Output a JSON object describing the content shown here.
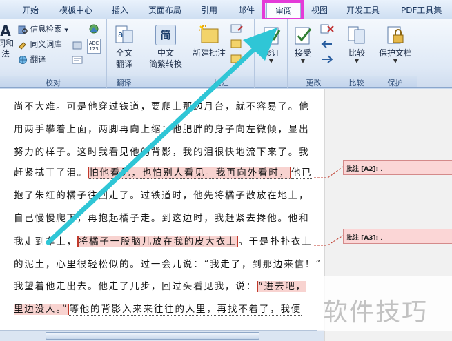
{
  "tabs": [
    "开始",
    "模板中心",
    "插入",
    "页面布局",
    "引用",
    "邮件",
    "审阅",
    "视图",
    "开发工具",
    "PDF工具集"
  ],
  "active_tab": "审阅",
  "ribbon": {
    "proofing": {
      "label": "校对",
      "spell_top": "A",
      "spell_bottom": "词和\n法",
      "research": "信息检索",
      "thesaurus": "同义词库",
      "translate": "翻译",
      "abc_text": "ABC\n123"
    },
    "translation": {
      "label": "翻译",
      "full_translate": "全文\n翻译"
    },
    "chinese": {
      "convert": "中文\n简繁转换",
      "convert_icon_char": "简"
    },
    "comments": {
      "label": "批注",
      "new_comment": "新建批注"
    },
    "tracking": {
      "label": "修订",
      "track": "修订"
    },
    "changes": {
      "label": "更改",
      "accept": "接受"
    },
    "compare": {
      "label": "比较",
      "compare": "比较"
    },
    "protect": {
      "label": "保护",
      "protect_doc": "保护文档"
    }
  },
  "document": {
    "lines": [
      {
        "text": "尚不大难。可是他穿过铁道，要爬上那边月台，就不容易了。他"
      },
      {
        "text": "用两手攀着上面，两脚再向上缩；他肥胖的身子向左微倾，显出"
      },
      {
        "text": "努力的样子。这时我看见他的背影，我的泪很快地流下来了。我"
      },
      {
        "pre": "赶紧拭干了泪。",
        "marked": "怕他看见，也怕别人看见。我再向外看时，",
        "post": "他已"
      },
      {
        "text": "抱了朱红的橘子往回走了。过铁道时，他先将橘子散放在地上，"
      },
      {
        "text": "自己慢慢爬下，再抱起橘子走。到这边时，我赶紧去搀他。他和"
      },
      {
        "pre": "我走到车上，",
        "marked": "将橘子一股脑儿放在我的皮大衣上",
        "post": "。于是扑扑衣上"
      },
      {
        "text": "的泥土，心里很轻松似的。过一会儿说：“我走了，到那边来信！”"
      },
      {
        "pre": "我望着他走出去。他走了几步，回过头看见我，说：",
        "marked": "“进去吧，"
      },
      {
        "marked": "里边没人。”",
        "post": "等他的背影入来来往往的人里，再找不着了，我便"
      }
    ]
  },
  "comments": [
    {
      "label": "批注 [A2]:",
      "suffix": "."
    },
    {
      "label": "批注 [A3]:",
      "suffix": "."
    }
  ],
  "watermark": "软件技巧",
  "colors": {
    "highlight_box": "#e43bd8",
    "arrow": "#2fc6d6",
    "comment_bg": "#fbd6d6",
    "mark_bg": "#f8d3d0"
  }
}
